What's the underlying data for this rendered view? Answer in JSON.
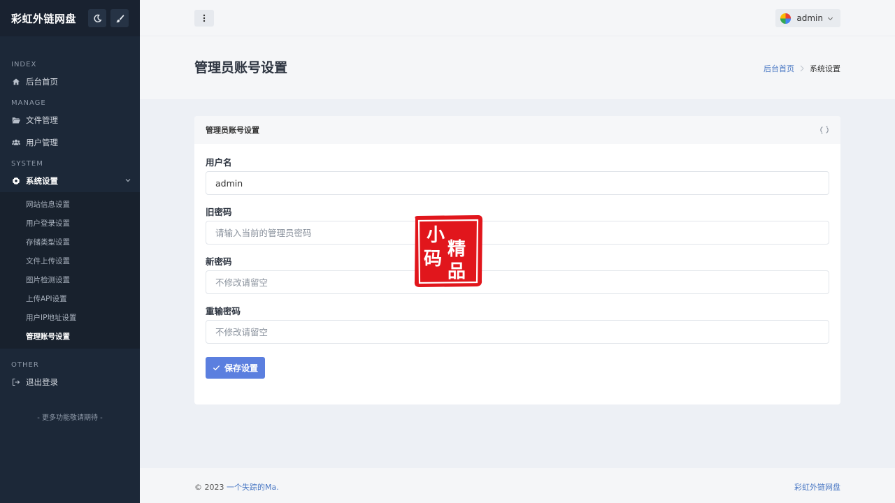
{
  "sidebar": {
    "brand": "彩虹外链网盘",
    "sections": {
      "index": "INDEX",
      "manage": "MANAGE",
      "system": "SYSTEM",
      "other": "OTHER"
    },
    "items": {
      "home": "后台首页",
      "files": "文件管理",
      "users": "用户管理",
      "settings": "系统设置",
      "logout": "退出登录"
    },
    "submenu": [
      "网站信息设置",
      "用户登录设置",
      "存储类型设置",
      "文件上传设置",
      "图片检测设置",
      "上传API设置",
      "用户IP地址设置",
      "管理账号设置"
    ],
    "more": "- 更多功能敬请期待 -"
  },
  "topbar": {
    "username": "admin"
  },
  "page": {
    "title": "管理员账号设置",
    "breadcrumb_home": "后台首页",
    "breadcrumb_current": "系统设置"
  },
  "card": {
    "title": "管理员账号设置",
    "fields": {
      "username_label": "用户名",
      "username_value": "admin",
      "old_password_label": "旧密码",
      "old_password_placeholder": "请输入当前的管理员密码",
      "new_password_label": "新密码",
      "new_password_placeholder": "不修改请留空",
      "confirm_password_label": "重输密码",
      "confirm_password_placeholder": "不修改请留空"
    },
    "save_label": "保存设置"
  },
  "stamp": {
    "text": "小码精品"
  },
  "footer": {
    "copyright": "© 2023 ",
    "author": "一个失踪的Ma.",
    "brand": "彩虹外链网盘"
  },
  "colors": {
    "sidebar_bg": "#1c2838",
    "accent": "#5b7fdf",
    "link": "#4a78c4",
    "stamp_red": "#e1161c"
  }
}
